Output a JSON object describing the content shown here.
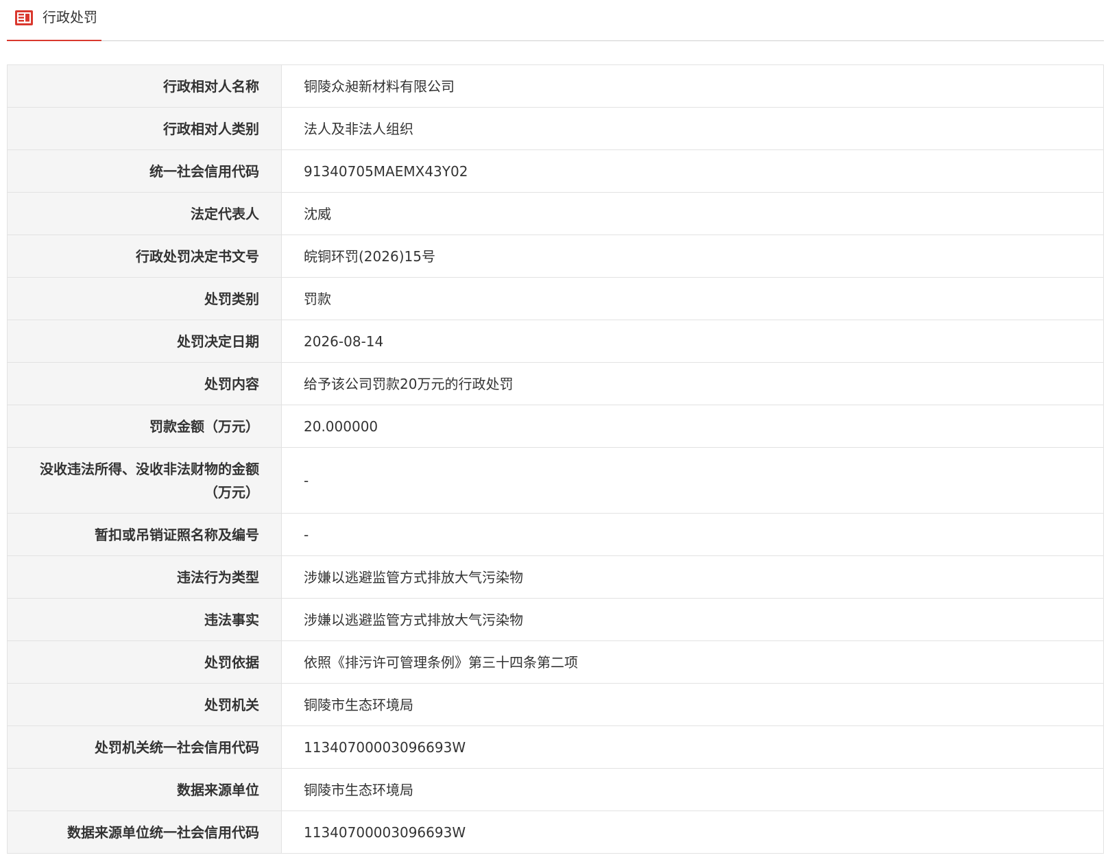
{
  "tab": {
    "icon": "document-list-icon",
    "label": "行政处罚",
    "accent_color": "#d9382e"
  },
  "rows": [
    {
      "label": "行政相对人名称",
      "value": "铜陵众昶新材料有限公司"
    },
    {
      "label": "行政相对人类别",
      "value": "法人及非法人组织"
    },
    {
      "label": "统一社会信用代码",
      "value": "91340705MAEMX43Y02"
    },
    {
      "label": "法定代表人",
      "value": "沈威"
    },
    {
      "label": "行政处罚决定书文号",
      "value": "皖铜环罚(2026)15号"
    },
    {
      "label": "处罚类别",
      "value": "罚款"
    },
    {
      "label": "处罚决定日期",
      "value": "2026-08-14"
    },
    {
      "label": "处罚内容",
      "value": "给予该公司罚款20万元的行政处罚"
    },
    {
      "label": "罚款金额（万元）",
      "value": "20.000000"
    },
    {
      "label": "没收违法所得、没收非法财物的金额（万元）",
      "value": "-"
    },
    {
      "label": "暂扣或吊销证照名称及编号",
      "value": "-"
    },
    {
      "label": "违法行为类型",
      "value": "涉嫌以逃避监管方式排放大气污染物"
    },
    {
      "label": "违法事实",
      "value": "涉嫌以逃避监管方式排放大气污染物"
    },
    {
      "label": "处罚依据",
      "value": "依照《排污许可管理条例》第三十四条第二项"
    },
    {
      "label": "处罚机关",
      "value": "铜陵市生态环境局"
    },
    {
      "label": "处罚机关统一社会信用代码",
      "value": "11340700003096693W"
    },
    {
      "label": "数据来源单位",
      "value": "铜陵市生态环境局"
    },
    {
      "label": "数据来源单位统一社会信用代码",
      "value": "11340700003096693W"
    }
  ]
}
